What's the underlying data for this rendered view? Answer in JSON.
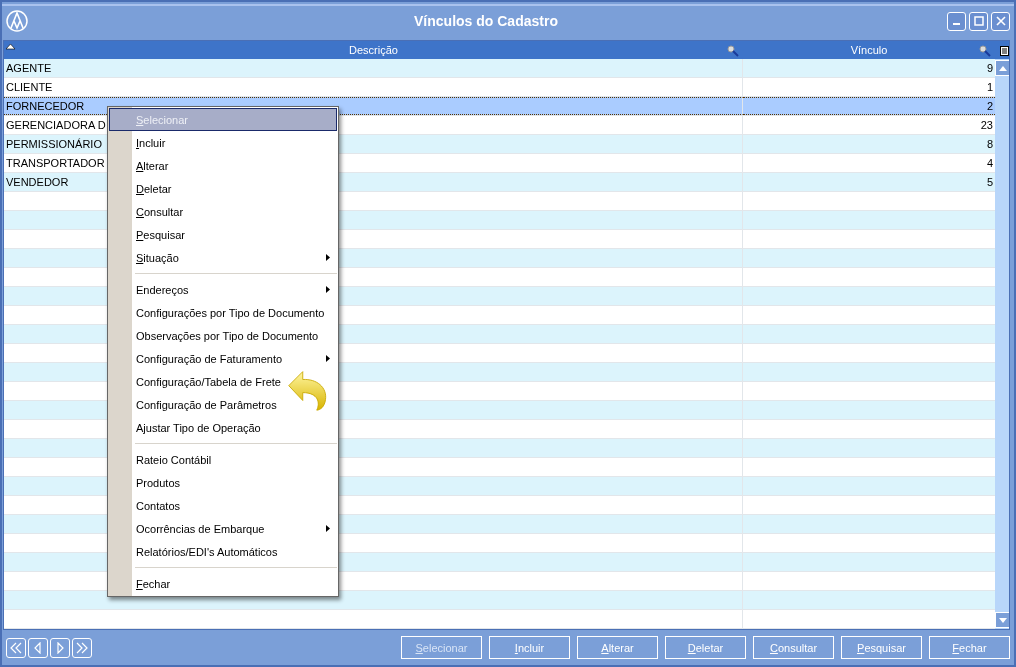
{
  "window": {
    "title": "Vínculos do Cadastro"
  },
  "table": {
    "columns": [
      {
        "label": "Descrição"
      },
      {
        "label": "Vínculo"
      }
    ],
    "rows": [
      {
        "cells": [
          "AGENTE",
          "9"
        ],
        "selected": false
      },
      {
        "cells": [
          "CLIENTE",
          "1"
        ],
        "selected": false
      },
      {
        "cells": [
          "FORNECEDOR",
          "2"
        ],
        "selected": true
      },
      {
        "cells": [
          "GERENCIADORA D",
          "23"
        ],
        "selected": false
      },
      {
        "cells": [
          "PERMISSIONÁRIO",
          "8"
        ],
        "selected": false
      },
      {
        "cells": [
          "TRANSPORTADOR",
          "4"
        ],
        "selected": false
      },
      {
        "cells": [
          "VENDEDOR",
          "5"
        ],
        "selected": false
      }
    ]
  },
  "context_menu": {
    "items": [
      {
        "kind": "item",
        "label": "Selecionar",
        "mnemonic": true,
        "selected": true,
        "disabled": true,
        "submenu": false
      },
      {
        "kind": "item",
        "label": "Incluir",
        "mnemonic": true,
        "selected": false,
        "disabled": false,
        "submenu": false
      },
      {
        "kind": "item",
        "label": "Alterar",
        "mnemonic": true,
        "selected": false,
        "disabled": false,
        "submenu": false
      },
      {
        "kind": "item",
        "label": "Deletar",
        "mnemonic": true,
        "selected": false,
        "disabled": false,
        "submenu": false
      },
      {
        "kind": "item",
        "label": "Consultar",
        "mnemonic": true,
        "selected": false,
        "disabled": false,
        "submenu": false
      },
      {
        "kind": "item",
        "label": "Pesquisar",
        "mnemonic": true,
        "selected": false,
        "disabled": false,
        "submenu": false
      },
      {
        "kind": "item",
        "label": "Situação",
        "mnemonic": true,
        "selected": false,
        "disabled": false,
        "submenu": true
      },
      {
        "kind": "separator"
      },
      {
        "kind": "item",
        "label": "Endereços",
        "mnemonic": false,
        "selected": false,
        "disabled": false,
        "submenu": true
      },
      {
        "kind": "item",
        "label": "Configurações por Tipo de Documento",
        "mnemonic": false,
        "selected": false,
        "disabled": false,
        "submenu": false
      },
      {
        "kind": "item",
        "label": "Observações por Tipo de Documento",
        "mnemonic": false,
        "selected": false,
        "disabled": false,
        "submenu": false
      },
      {
        "kind": "item",
        "label": "Configuração de Faturamento",
        "mnemonic": false,
        "selected": false,
        "disabled": false,
        "submenu": true
      },
      {
        "kind": "item",
        "label": "Configuração/Tabela de Frete",
        "mnemonic": false,
        "selected": false,
        "disabled": false,
        "submenu": false
      },
      {
        "kind": "item",
        "label": "Configuração de Parâmetros",
        "mnemonic": false,
        "selected": false,
        "disabled": false,
        "submenu": false
      },
      {
        "kind": "item",
        "label": "Ajustar Tipo de Operação",
        "mnemonic": false,
        "selected": false,
        "disabled": false,
        "submenu": false
      },
      {
        "kind": "separator"
      },
      {
        "kind": "item",
        "label": "Rateio Contábil",
        "mnemonic": false,
        "selected": false,
        "disabled": false,
        "submenu": false
      },
      {
        "kind": "item",
        "label": "Produtos",
        "mnemonic": false,
        "selected": false,
        "disabled": false,
        "submenu": false
      },
      {
        "kind": "item",
        "label": "Contatos",
        "mnemonic": false,
        "selected": false,
        "disabled": false,
        "submenu": false
      },
      {
        "kind": "item",
        "label": "Ocorrências de Embarque",
        "mnemonic": false,
        "selected": false,
        "disabled": false,
        "submenu": true
      },
      {
        "kind": "item",
        "label": "Relatórios/EDI's Automáticos",
        "mnemonic": false,
        "selected": false,
        "disabled": false,
        "submenu": false
      },
      {
        "kind": "separator"
      },
      {
        "kind": "item",
        "label": "Fechar",
        "mnemonic": true,
        "selected": false,
        "disabled": false,
        "submenu": false
      }
    ]
  },
  "buttons": [
    {
      "label": "Selecionar",
      "disabled": true
    },
    {
      "label": "Incluir",
      "disabled": false
    },
    {
      "label": "Alterar",
      "disabled": false
    },
    {
      "label": "Deletar",
      "disabled": false
    },
    {
      "label": "Consultar",
      "disabled": false
    },
    {
      "label": "Pesquisar",
      "disabled": false
    },
    {
      "label": "Fechar",
      "disabled": false
    }
  ]
}
